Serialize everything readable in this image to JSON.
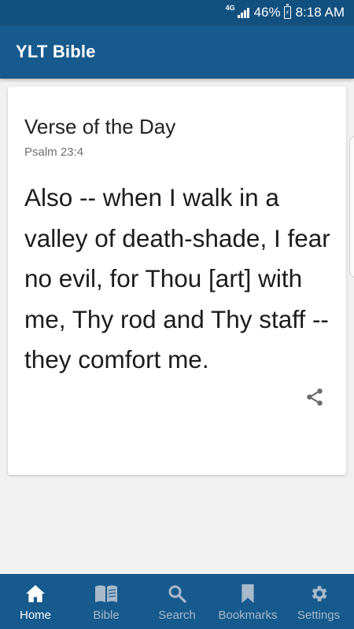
{
  "status_bar": {
    "network": "4G",
    "battery_percent": "46%",
    "time": "8:18 AM"
  },
  "app_bar": {
    "title": "YLT Bible"
  },
  "verse_card": {
    "heading": "Verse of the Day",
    "reference": "Psalm 23:4",
    "text": "Also -- when I walk in a valley of death-shade, I fear no evil, for Thou [art] with me, Thy rod and Thy staff -- they comfort me."
  },
  "bottom_nav": {
    "items": [
      {
        "label": "Home",
        "icon": "home-icon",
        "active": true
      },
      {
        "label": "Bible",
        "icon": "book-icon",
        "active": false
      },
      {
        "label": "Search",
        "icon": "search-icon",
        "active": false
      },
      {
        "label": "Bookmarks",
        "icon": "bookmark-icon",
        "active": false
      },
      {
        "label": "Settings",
        "icon": "gear-icon",
        "active": false
      }
    ]
  },
  "colors": {
    "primary": "#175a8d",
    "status_bar": "#12507f",
    "nav_inactive": "#a7b9cb",
    "background": "#f1f1f1"
  }
}
